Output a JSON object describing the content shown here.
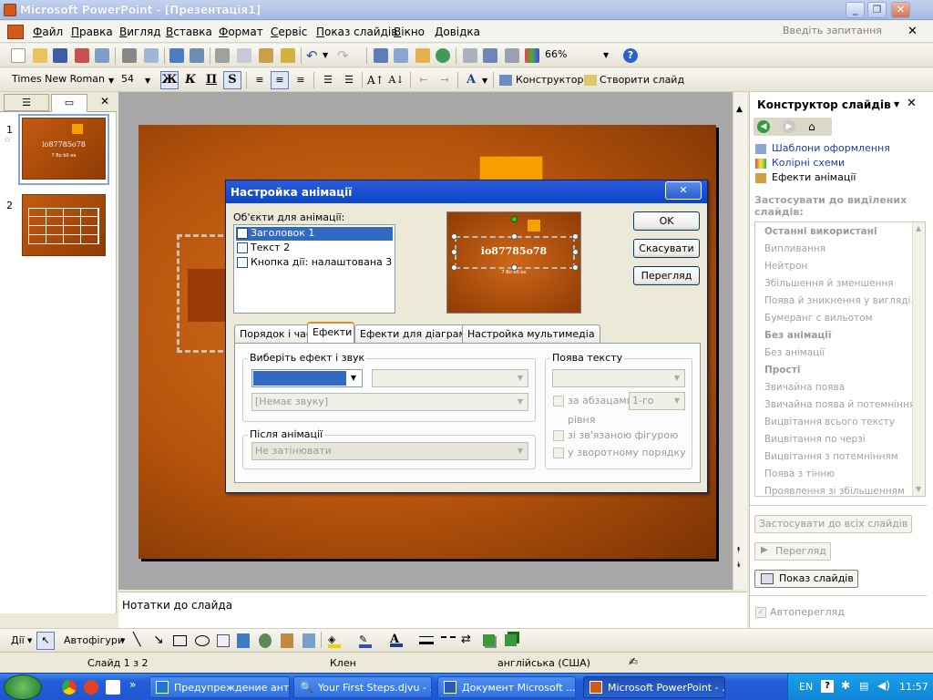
{
  "window": {
    "title": "Microsoft PowerPoint - [Презентація1]"
  },
  "menu": [
    "Файл",
    "Правка",
    "Вигляд",
    "Вставка",
    "Формат",
    "Сервіс",
    "Показ слайдів",
    "Вікно",
    "Довідка"
  ],
  "ask_placeholder": "Введіть запитання",
  "toolbar": {
    "zoom": "66%"
  },
  "format": {
    "font": "Times New Roman",
    "size": "54",
    "bold": "Ж",
    "italic": "К",
    "underline": "П",
    "shadow": "S",
    "design_label": "Конструктор",
    "new_slide_label": "Створити слайд"
  },
  "slides": [
    {
      "num": "1",
      "title": "io87785o78",
      "subtitle": "7 Bo b0 ee"
    },
    {
      "num": "2"
    }
  ],
  "notes": "Нотатки до слайда",
  "taskpane": {
    "title": "Конструктор слайдів",
    "links": [
      "Шаблони оформлення",
      "Колірні схеми",
      "Ефекти анімації"
    ],
    "apply_label": "Застосувати до виділених слайдів:",
    "items": [
      {
        "t": "Останні використані",
        "h": true
      },
      {
        "t": "Випливання"
      },
      {
        "t": "Нейтрон"
      },
      {
        "t": "Збільшення й зменшення"
      },
      {
        "t": "Поява й зникнення у вигляді..."
      },
      {
        "t": "Бумеранг с вильотом"
      },
      {
        "t": "Без анімації",
        "h": true
      },
      {
        "t": "Без анімації"
      },
      {
        "t": "Прості",
        "h": true
      },
      {
        "t": "Звичайна поява"
      },
      {
        "t": "Звичайна поява й потемніння"
      },
      {
        "t": "Вицвітання всього тексту"
      },
      {
        "t": "Вицвітання по черзі"
      },
      {
        "t": "Вицвітання з потемнінням"
      },
      {
        "t": "Поява з тінню"
      },
      {
        "t": "Проявлення зі збільшенням"
      }
    ],
    "apply_all": "Застосувати до всіх слайдів",
    "preview": "Перегляд",
    "slideshow": "Показ слайдів",
    "autopreview": "Автоперегляд"
  },
  "dialog": {
    "title": "Настройка анімації",
    "objects_label": "Об'єкти для анімації:",
    "objects": [
      "Заголовок 1",
      "Текст 2",
      "Кнопка дії: налаштована 3"
    ],
    "preview_title": "io87785o78",
    "preview_subtitle": "7 Bo b0 ee",
    "ok": "OK",
    "cancel": "Скасувати",
    "preview": "Перегляд",
    "tabs": [
      "Порядок і час",
      "Ефекти",
      "Ефекти для діаграми",
      "Настройка мультимедіа"
    ],
    "effect_group": "Виберіть ефект і звук",
    "sound": "[Немає звуку]",
    "after_group": "Після анімації",
    "after_value": "Не затінювати",
    "text_group": "Поява тексту",
    "by_paragraphs": "за абзацами",
    "level_value": "1-го",
    "level_label": "рівня",
    "attached": "зі зв'язаною фігурою",
    "reverse": "у зворотному порядку"
  },
  "drawbar": {
    "actions": "Дії",
    "autoshapes": "Автофігури"
  },
  "status": {
    "slide": "Слайд 1 з 2",
    "design": "Клен",
    "language": "англійська (США)"
  },
  "taskbar": {
    "buttons": [
      "Предупреждение ант...",
      "Your First Steps.djvu - ...",
      "Документ Microsoft ...",
      "Microsoft PowerPoint - ..."
    ],
    "lang": "EN",
    "clock": "11:57"
  },
  "colors": {
    "accent": "#2c5ad8",
    "slide_orange": "#c55a10"
  }
}
